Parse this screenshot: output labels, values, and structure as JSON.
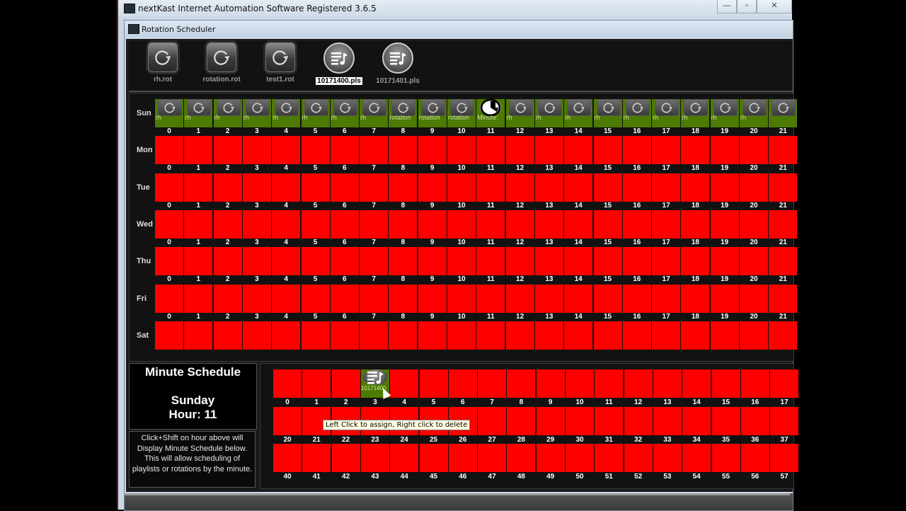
{
  "window": {
    "title": "nextKast Internet Automation Software Registered 3.6.5",
    "buttons": {
      "minimize": "—",
      "maximize": "▫",
      "close": "✕"
    }
  },
  "dialog": {
    "title": "Rotation Scheduler"
  },
  "toolbar": {
    "items": [
      {
        "label": "rh.rot",
        "type": "rotation",
        "selected": false
      },
      {
        "label": "rotation.rot",
        "type": "rotation",
        "selected": false
      },
      {
        "label": "test1.rot",
        "type": "rotation",
        "selected": false
      },
      {
        "label": "10171400.pls",
        "type": "playlist",
        "selected": true
      },
      {
        "label": "10171401.pls",
        "type": "playlist",
        "selected": false
      }
    ]
  },
  "week": {
    "days": [
      "Sun",
      "Mon",
      "Tue",
      "Wed",
      "Thu",
      "Fri",
      "Sat"
    ],
    "hours_visible": [
      "0",
      "1",
      "2",
      "3",
      "4",
      "5",
      "6",
      "7",
      "8",
      "9",
      "10",
      "11",
      "12",
      "13",
      "14",
      "15",
      "16",
      "17",
      "18",
      "19",
      "20",
      "21"
    ],
    "sunday_assignments": [
      {
        "hour": 0,
        "label": "rh",
        "icon": "rotation"
      },
      {
        "hour": 1,
        "label": "rh",
        "icon": "rotation"
      },
      {
        "hour": 2,
        "label": "rh",
        "icon": "rotation"
      },
      {
        "hour": 3,
        "label": "rh",
        "icon": "rotation"
      },
      {
        "hour": 4,
        "label": "rh",
        "icon": "rotation"
      },
      {
        "hour": 5,
        "label": "rh",
        "icon": "rotation"
      },
      {
        "hour": 6,
        "label": "rh",
        "icon": "rotation"
      },
      {
        "hour": 7,
        "label": "rh",
        "icon": "rotation"
      },
      {
        "hour": 8,
        "label": "rotation",
        "icon": "rotation"
      },
      {
        "hour": 9,
        "label": "rotation",
        "icon": "rotation"
      },
      {
        "hour": 10,
        "label": "rotation",
        "icon": "rotation"
      },
      {
        "hour": 11,
        "label": "Minute:",
        "icon": "clock"
      },
      {
        "hour": 12,
        "label": "rh",
        "icon": "rotation"
      },
      {
        "hour": 13,
        "label": "rh",
        "icon": "rotation"
      },
      {
        "hour": 14,
        "label": "rh",
        "icon": "rotation"
      },
      {
        "hour": 15,
        "label": "rh",
        "icon": "rotation"
      },
      {
        "hour": 16,
        "label": "rh",
        "icon": "rotation"
      },
      {
        "hour": 17,
        "label": "rh",
        "icon": "rotation"
      },
      {
        "hour": 18,
        "label": "rh",
        "icon": "rotation"
      },
      {
        "hour": 19,
        "label": "rh",
        "icon": "rotation"
      },
      {
        "hour": 20,
        "label": "rh",
        "icon": "rotation"
      },
      {
        "hour": 21,
        "label": "",
        "icon": "rotation"
      }
    ],
    "colors": {
      "unassigned": "#ff0000",
      "assigned": "#4d7a00"
    }
  },
  "minute_schedule": {
    "title": "Minute Schedule",
    "day": "Sunday",
    "hour_label": "Hour: 11",
    "help_text": "Click+Shift on hour above will Display Minute Schedule below. This will allow scheduling of playlists or rotations by the minute.",
    "rows": [
      [
        "0",
        "1",
        "2",
        "3",
        "4",
        "5",
        "6",
        "7",
        "8",
        "9",
        "10",
        "11",
        "12",
        "13",
        "14",
        "15",
        "16",
        "17"
      ],
      [
        "20",
        "21",
        "22",
        "23",
        "24",
        "25",
        "26",
        "27",
        "28",
        "29",
        "30",
        "31",
        "32",
        "33",
        "34",
        "35",
        "36",
        "37"
      ],
      [
        "40",
        "41",
        "42",
        "43",
        "44",
        "45",
        "46",
        "47",
        "48",
        "49",
        "50",
        "51",
        "52",
        "53",
        "54",
        "55",
        "56",
        "57"
      ]
    ],
    "assignments": [
      {
        "minute": 3,
        "label": "10171400",
        "icon": "playlist"
      }
    ],
    "tooltip": "Left Click to assign, Right click to delete"
  }
}
